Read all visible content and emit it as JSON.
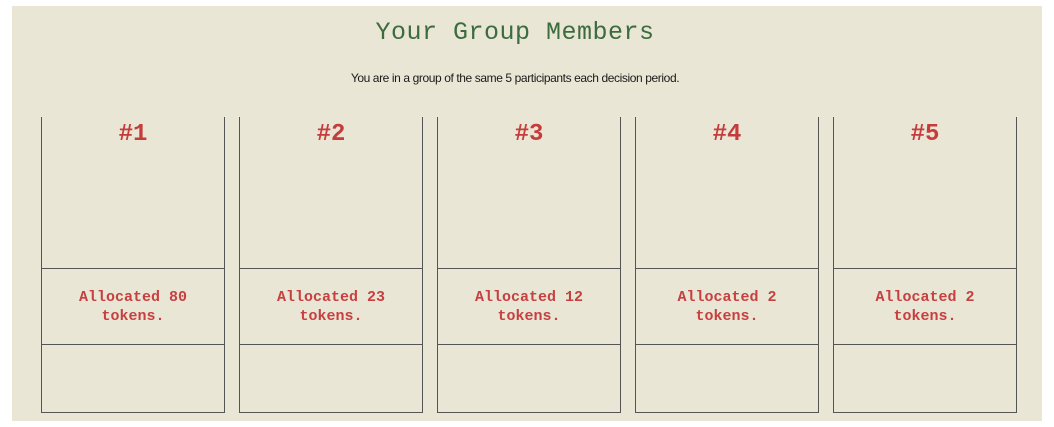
{
  "header": {
    "title": "Your Group Members",
    "subtitle": "You are in a group of the same 5 participants each decision period."
  },
  "members": [
    {
      "label": "#1",
      "allocation": "Allocated 80 tokens."
    },
    {
      "label": "#2",
      "allocation": "Allocated 23 tokens."
    },
    {
      "label": "#3",
      "allocation": "Allocated 12 tokens."
    },
    {
      "label": "#4",
      "allocation": "Allocated 2 tokens."
    },
    {
      "label": "#5",
      "allocation": "Allocated 2 tokens."
    }
  ],
  "colors": {
    "background": "#e9e6d5",
    "title": "#3c6c3e",
    "member_text": "#c63b3b",
    "border": "#555555"
  }
}
